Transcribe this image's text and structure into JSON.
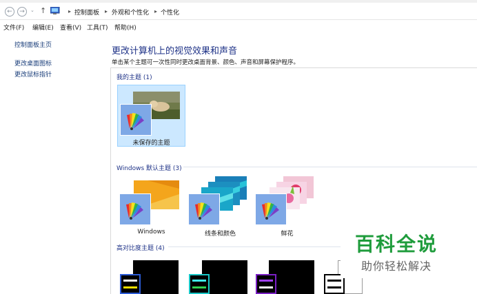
{
  "address_bar": {
    "back_icon": "back-arrow-icon",
    "forward_icon": "forward-arrow-icon",
    "breadcrumbs": [
      "控制面板",
      "外观和个性化",
      "个性化"
    ]
  },
  "menu": {
    "items": [
      "文件(F)",
      "编辑(E)",
      "查看(V)",
      "工具(T)",
      "帮助(H)"
    ]
  },
  "sidebar": {
    "links": [
      "控制面板主页",
      "更改桌面图标",
      "更改鼠标指针"
    ]
  },
  "main": {
    "title": "更改计算机上的视觉效果和声音",
    "description": "单击某个主题可一次性同时更改桌面背景、颜色、声音和屏幕保护程序。"
  },
  "groups": {
    "my_themes": {
      "header": "我的主题 (1)",
      "items": [
        {
          "label": "未保存的主题",
          "selected": true
        }
      ]
    },
    "windows_themes": {
      "header": "Windows 默认主题 (3)",
      "items": [
        {
          "label": "Windows"
        },
        {
          "label": "线条和颜色"
        },
        {
          "label": "鲜花"
        }
      ]
    },
    "high_contrast": {
      "header": "高对比度主题 (4)"
    }
  },
  "watermark": {
    "title": "百科全说",
    "subtitle": "助你轻松解决"
  },
  "colors": {
    "link": "#1a3e7a",
    "title": "#1e3287",
    "selection": "#cce8ff",
    "watermark_green": "#1f9c3c"
  }
}
